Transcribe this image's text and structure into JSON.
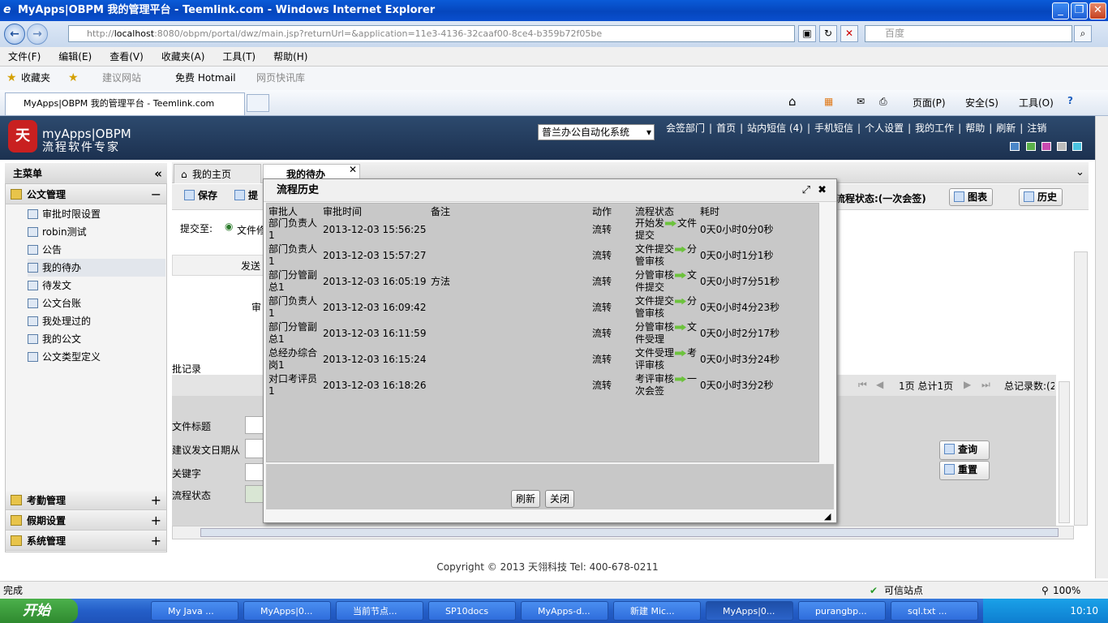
{
  "window": {
    "title": "MyApps|OBPM 我的管理平台 - Teemlink.com - Windows Internet Explorer"
  },
  "address": {
    "url_host": "localhost",
    "url_pre": "http://",
    "url_rest": ":8080/obpm/portal/dwz/main.jsp?returnUrl=&application=11e3-4136-32caaf00-8ce4-b359b72f05be",
    "search_placeholder": "百度"
  },
  "menu": [
    "文件(F)",
    "编辑(E)",
    "查看(V)",
    "收藏夹(A)",
    "工具(T)",
    "帮助(H)"
  ],
  "favorites": {
    "label": "收藏夹",
    "items": [
      "建议网站",
      "免费 Hotmail",
      "网页快讯库"
    ]
  },
  "browser_tab": {
    "title": "MyApps|OBPM 我的管理平台 - Teemlink.com"
  },
  "cmd": {
    "page": "页面(P)",
    "safety": "安全(S)",
    "tools": "工具(O)"
  },
  "header": {
    "brand_line1": "myApps|OBPM",
    "brand_line2": "流程软件专家",
    "system_select": "普兰办公自动化系统",
    "links": [
      "会签部门",
      "首页",
      "站内短信 (4)",
      "手机短信",
      "个人设置",
      "我的工作",
      "帮助",
      "刷新",
      "注销"
    ]
  },
  "sidebar": {
    "title": "主菜单",
    "sections": [
      {
        "label": "公文管理",
        "toggle": "−"
      },
      {
        "label": "考勤管理",
        "toggle": "+"
      },
      {
        "label": "假期设置",
        "toggle": "+"
      },
      {
        "label": "系统管理",
        "toggle": "+"
      }
    ],
    "items": [
      "审批时限设置",
      "robin测试",
      "公告",
      "我的待办",
      "待发文",
      "公文台账",
      "我处理过的",
      "我的公文",
      "公文类型定义"
    ]
  },
  "tabs": {
    "home": "我的主页",
    "todo": "我的待办"
  },
  "toolbar": {
    "save": "保存",
    "submit": "提交",
    "status": "流程状态:(一次会签)",
    "chart": "图表",
    "history": "历史"
  },
  "form": {
    "submit_to": "提交至:",
    "option": "文件修",
    "send": "发送",
    "audit": "审",
    "records": "批记录",
    "fields": [
      "文件标题",
      "建议发文日期从",
      "关键字",
      "流程状态"
    ],
    "pager": "1页 总计1页",
    "total": "总记录数:(2",
    "query": "查询",
    "reset": "重置"
  },
  "dialog": {
    "title": "流程历史",
    "columns": [
      "审批人",
      "审批时间",
      "备注",
      "动作",
      "流程状态",
      "耗时"
    ],
    "rows": [
      {
        "approver": "部门负责人1",
        "time": "2013-12-03 15:56:25",
        "note": "",
        "action": "流转",
        "from": "开始发",
        "to": "文件提交",
        "duration": "0天0小时0分0秒"
      },
      {
        "approver": "部门负责人1",
        "time": "2013-12-03 15:57:27",
        "note": "",
        "action": "流转",
        "from": "文件提交",
        "to": "分管审核",
        "duration": "0天0小时1分1秒"
      },
      {
        "approver": "部门分管副总1",
        "time": "2013-12-03 16:05:19",
        "note": "方法",
        "action": "流转",
        "from": "分管审核",
        "to": "文件提交",
        "duration": "0天0小时7分51秒"
      },
      {
        "approver": "部门负责人1",
        "time": "2013-12-03 16:09:42",
        "note": "",
        "action": "流转",
        "from": "文件提交",
        "to": "分管审核",
        "duration": "0天0小时4分23秒"
      },
      {
        "approver": "部门分管副总1",
        "time": "2013-12-03 16:11:59",
        "note": "",
        "action": "流转",
        "from": "分管审核",
        "to": "文件受理",
        "duration": "0天0小时2分17秒"
      },
      {
        "approver": "总经办综合岗1",
        "time": "2013-12-03 16:15:24",
        "note": "",
        "action": "流转",
        "from": "文件受理",
        "to": "考评审核",
        "duration": "0天0小时3分24秒"
      },
      {
        "approver": "对口考评员1",
        "time": "2013-12-03 16:18:26",
        "note": "",
        "action": "流转",
        "from": "考评审核",
        "to": "一次会签",
        "duration": "0天0小时3分2秒"
      }
    ],
    "refresh": "刷新",
    "close": "关闭"
  },
  "footer": "Copyright © 2013 天翎科技  Tel: 400-678-0211",
  "status": {
    "text": "完成",
    "zone": "可信站点",
    "zoom": "100%"
  },
  "taskbar": {
    "start": "开始",
    "tasks": [
      "My Java ...",
      "MyApps|0...",
      "当前节点...",
      "SP10docs",
      "MyApps-d...",
      "新建 Mic...",
      "MyApps|0...",
      "purangbp...",
      "sql.txt ..."
    ],
    "clock": "10:10"
  }
}
